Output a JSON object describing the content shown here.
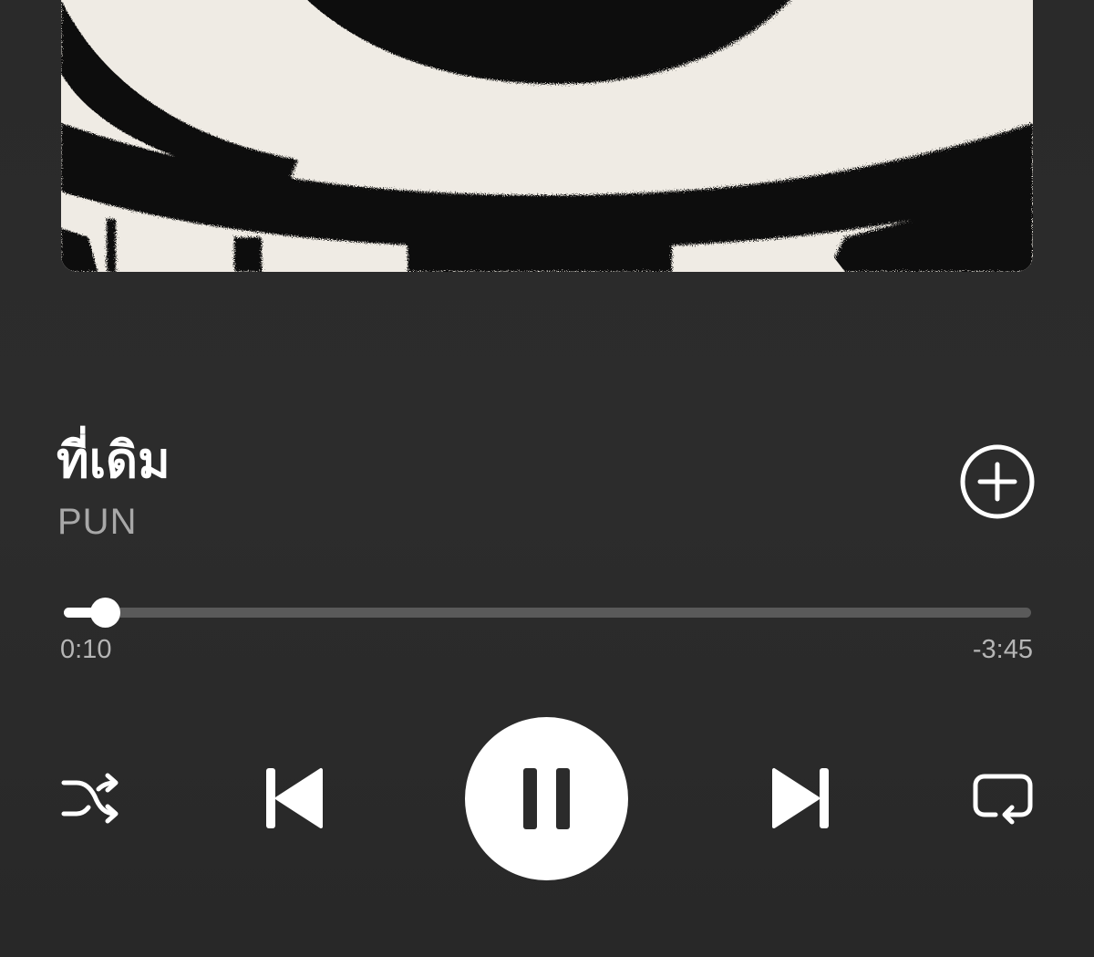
{
  "track": {
    "title": "ที่เดิม",
    "artist": "PUN"
  },
  "playback": {
    "elapsed": "0:10",
    "remaining": "-3:45",
    "progress_fraction": 0.042,
    "state": "playing"
  },
  "controls": {
    "add": "plus-circle-icon",
    "shuffle": "shuffle-icon",
    "previous": "skip-back-icon",
    "play_pause": "pause-icon",
    "next": "skip-forward-icon",
    "repeat": "repeat-icon"
  },
  "colors": {
    "background": "#2b2b2b",
    "primary_text": "#ffffff",
    "secondary_text": "#a8a8a8",
    "progress_track": "#5a5a5a"
  }
}
